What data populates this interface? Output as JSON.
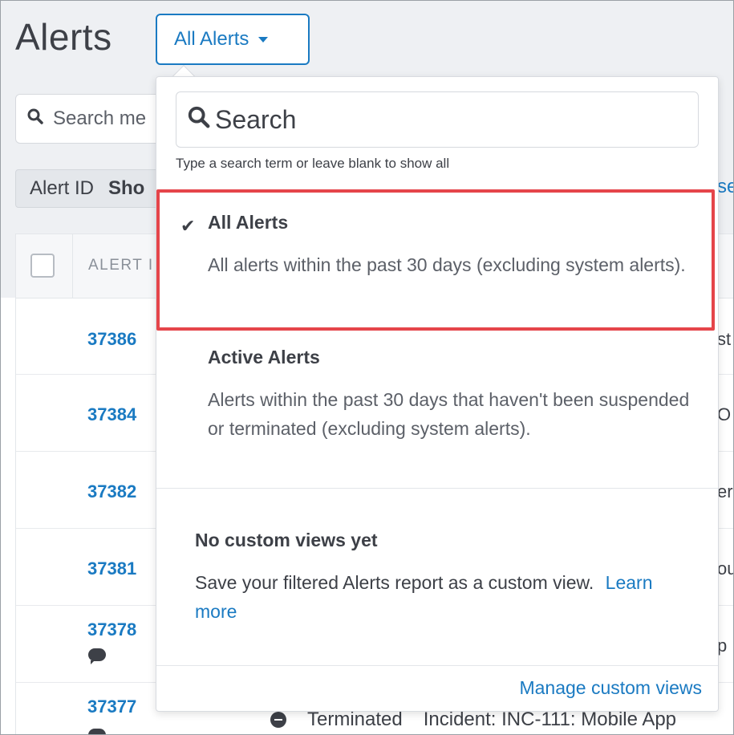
{
  "header": {
    "title": "Alerts",
    "view_selector": {
      "label": "All Alerts"
    }
  },
  "background": {
    "search_placeholder": "Search me",
    "filter_label": "Alert ID",
    "filter_value": "Sho",
    "right_link_fragment": "se",
    "table": {
      "column_header": "ALERT I",
      "rows": [
        {
          "id": "37386",
          "frag": "st",
          "has_comment": false
        },
        {
          "id": "37384",
          "frag": "O",
          "has_comment": false
        },
        {
          "id": "37382",
          "frag": "er",
          "has_comment": false
        },
        {
          "id": "37381",
          "frag": "ou",
          "has_comment": false
        },
        {
          "id": "37378",
          "frag": "p",
          "has_comment": true
        },
        {
          "id": "37377",
          "frag": "",
          "has_comment": true
        }
      ],
      "bottom_row": {
        "status": "Terminated",
        "description": "Incident: INC-111: Mobile App"
      }
    }
  },
  "dropdown": {
    "search_placeholder": "Search",
    "hint": "Type a search term or leave blank to show all",
    "options": [
      {
        "title": "All Alerts",
        "description": "All alerts within the past 30 days (excluding system alerts).",
        "selected": true
      },
      {
        "title": "Active Alerts",
        "description": "Alerts within the past 30 days that haven't been suspended or terminated (excluding system alerts).",
        "selected": false
      }
    ],
    "custom_views": {
      "title": "No custom views yet",
      "description": "Save your filtered Alerts report as a custom view.",
      "learn_more": "Learn more"
    },
    "footer_link": "Manage custom views"
  },
  "colors": {
    "accent": "#1a7ac2",
    "highlight": "#e5454a"
  }
}
